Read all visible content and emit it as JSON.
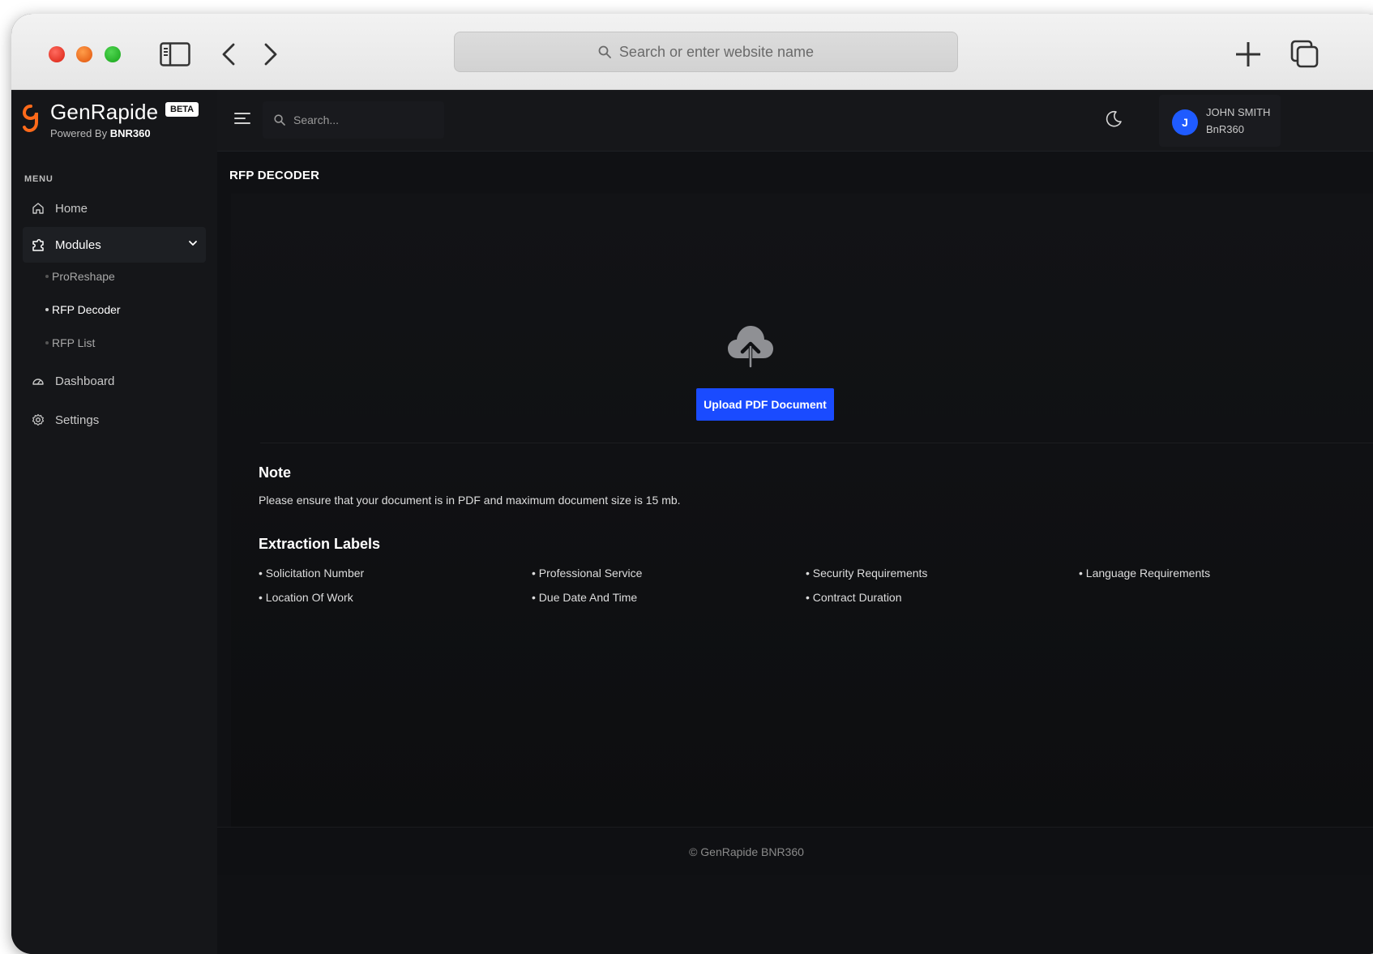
{
  "browser": {
    "address_placeholder": "Search or enter website name"
  },
  "app": {
    "brand": "GenRapide",
    "beta_badge": "BETA",
    "powered_by_prefix": "Powered By",
    "powered_by_name": "BNR360",
    "accent_color": "#1a4bff",
    "logo_color": "#ff6a1a"
  },
  "sidebar": {
    "menu_label": "MENU",
    "items": [
      {
        "label": "Home",
        "icon": "home-icon"
      },
      {
        "label": "Modules",
        "icon": "modules-icon",
        "expanded": true
      },
      {
        "label": "Dashboard",
        "icon": "dashboard-icon"
      },
      {
        "label": "Settings",
        "icon": "settings-icon"
      }
    ],
    "sub_items": [
      {
        "label": "ProReshape"
      },
      {
        "label": "RFP Decoder",
        "active": true
      },
      {
        "label": "RFP List"
      }
    ]
  },
  "topbar": {
    "search_placeholder": "Search...",
    "user": {
      "initial": "J",
      "name": "JOHN SMITH",
      "org": "BnR360"
    }
  },
  "main": {
    "title": "RFP DECODER",
    "upload_button": "Upload PDF Document",
    "note_heading": "Note",
    "note_text": "Please ensure that your document is in PDF and maximum document size is 15 mb.",
    "extraction_heading": "Extraction Labels",
    "extraction_labels": [
      "• Solicitation Number",
      "• Professional Service",
      "• Security Requirements",
      "• Language Requirements",
      "• Location Of Work",
      "• Due Date And Time",
      "• Contract Duration"
    ]
  },
  "footer": {
    "text": "© GenRapide BNR360"
  }
}
